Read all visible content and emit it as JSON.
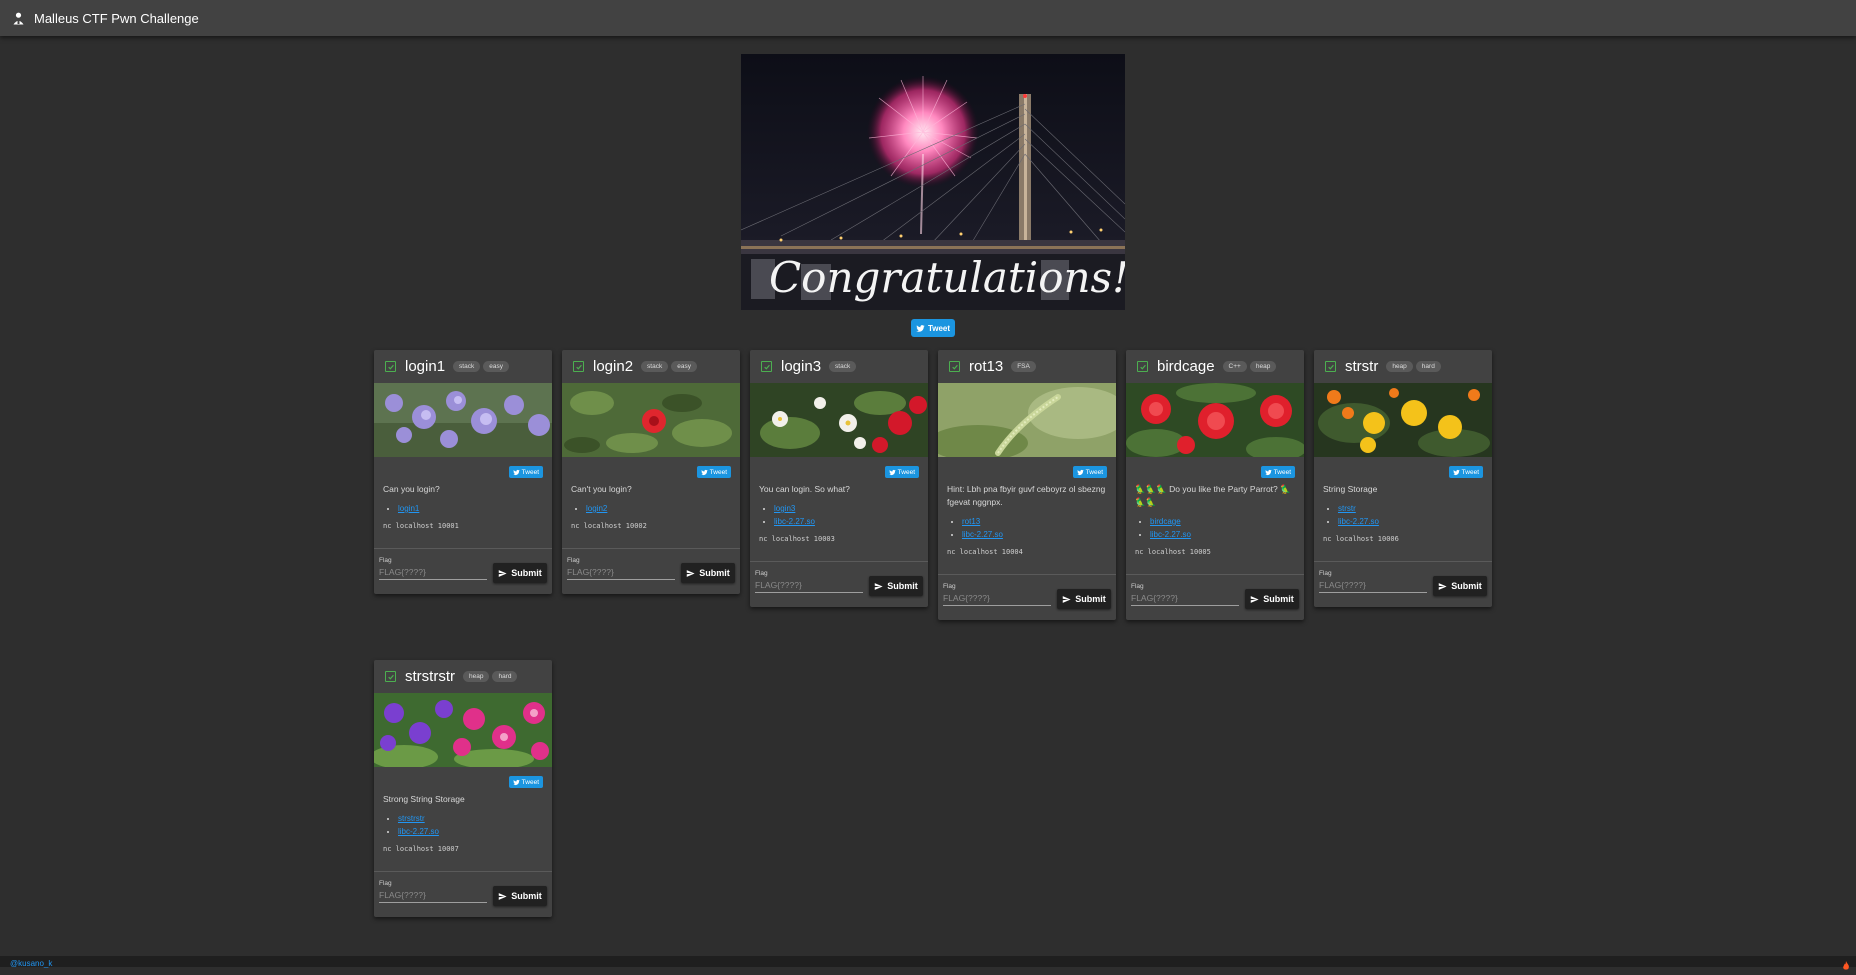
{
  "app": {
    "title": "Malleus CTF Pwn Challenge"
  },
  "banner": {
    "text": "Congratulations!",
    "tweet_label": "Tweet"
  },
  "colors": {
    "accent": "#2196f3",
    "twitter": "#1b95e0",
    "solved": "#4caf50",
    "card_bg": "#424242",
    "page_bg": "#2e2e2e"
  },
  "cards": [
    {
      "title": "login1",
      "tags": [
        "stack",
        "easy"
      ],
      "tweet": "Tweet",
      "description": "Can you login?",
      "links": [
        "login1"
      ],
      "nc": "nc localhost 10001",
      "flag_label": "Flag",
      "flag_placeholder": "FLAG{????}",
      "submit_label": "Submit"
    },
    {
      "title": "login2",
      "tags": [
        "stack",
        "easy"
      ],
      "tweet": "Tweet",
      "description": "Can't you login?",
      "links": [
        "login2"
      ],
      "nc": "nc localhost 10002",
      "flag_label": "Flag",
      "flag_placeholder": "FLAG{????}",
      "submit_label": "Submit"
    },
    {
      "title": "login3",
      "tags": [
        "stack"
      ],
      "tweet": "Tweet",
      "description": "You can login. So what?",
      "links": [
        "login3",
        "libc-2.27.so"
      ],
      "nc": "nc localhost 10003",
      "flag_label": "Flag",
      "flag_placeholder": "FLAG{????}",
      "submit_label": "Submit"
    },
    {
      "title": "rot13",
      "tags": [
        "FSA"
      ],
      "tweet": "Tweet",
      "description": "Hint: Lbh pna fbyir guvf ceboyrz ol sbezng fgevat nggnpx.",
      "links": [
        "rot13",
        "libc-2.27.so"
      ],
      "nc": "nc localhost 10004",
      "flag_label": "Flag",
      "flag_placeholder": "FLAG{????}",
      "submit_label": "Submit"
    },
    {
      "title": "birdcage",
      "tags": [
        "C++",
        "heap"
      ],
      "tweet": "Tweet",
      "description": "🦜🦜🦜 Do you like the Party Parrot? 🦜🦜🦜",
      "links": [
        "birdcage",
        "libc-2.27.so"
      ],
      "nc": "nc localhost 10005",
      "flag_label": "Flag",
      "flag_placeholder": "FLAG{????}",
      "submit_label": "Submit"
    },
    {
      "title": "strstr",
      "tags": [
        "heap",
        "hard"
      ],
      "tweet": "Tweet",
      "description": "String Storage",
      "links": [
        "strstr",
        "libc-2.27.so"
      ],
      "nc": "nc localhost 10006",
      "flag_label": "Flag",
      "flag_placeholder": "FLAG{????}",
      "submit_label": "Submit"
    },
    {
      "title": "strstrstr",
      "tags": [
        "heap",
        "hard"
      ],
      "tweet": "Tweet",
      "description": "Strong String Storage",
      "links": [
        "strstrstr",
        "libc-2.27.so"
      ],
      "nc": "nc localhost 10007",
      "flag_label": "Flag",
      "flag_placeholder": "FLAG{????}",
      "submit_label": "Submit"
    }
  ],
  "footer": {
    "link": "@kusano_k"
  }
}
